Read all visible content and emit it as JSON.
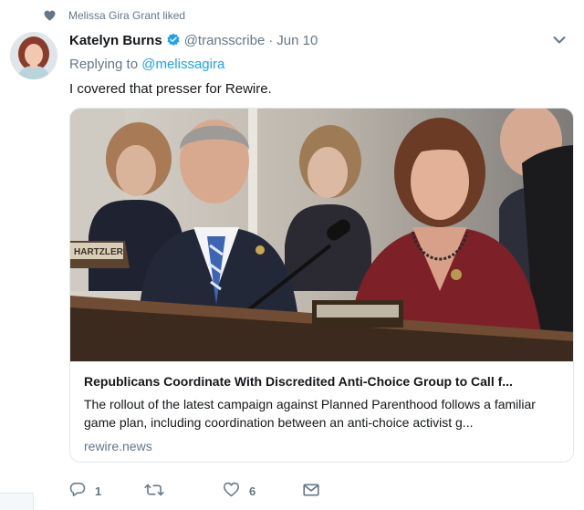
{
  "social_context": {
    "text": "Melissa Gira Grant liked",
    "icon": "heart-icon"
  },
  "tweet": {
    "fullname": "Katelyn Burns",
    "handle": "@transscribe",
    "separator": "·",
    "time": "Jun 10",
    "reply_prefix": "Replying to ",
    "reply_mention": "@melissagira",
    "text": "I covered that presser for Rewire."
  },
  "card": {
    "title": "Republicans Coordinate With Discredited Anti-Choice Group to Call f...",
    "description": "The rollout of the latest campaign against Planned Parenthood follows a familiar game plan, including coordination between an anti-choice activist g...",
    "domain": "rewire.news",
    "nameplate": "HARTZLER"
  },
  "actions": {
    "reply_count": "1",
    "retweet_count": "",
    "like_count": "6"
  },
  "colors": {
    "accent": "#1da1f2",
    "muted": "#657786",
    "border": "#e1e8ed"
  }
}
